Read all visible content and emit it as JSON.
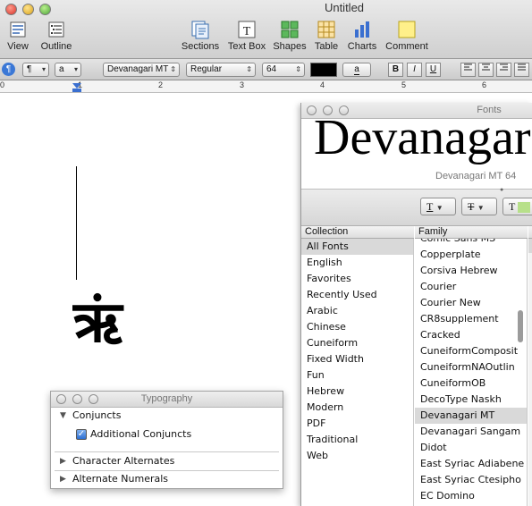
{
  "window": {
    "title": "Untitled"
  },
  "toolbar": {
    "items": [
      {
        "label": "View",
        "icon": "view-icon"
      },
      {
        "label": "Outline",
        "icon": "outline-icon"
      },
      {
        "label": "Sections",
        "icon": "sections-icon"
      },
      {
        "label": "Text Box",
        "icon": "text-box-icon"
      },
      {
        "label": "Shapes",
        "icon": "shapes-icon"
      },
      {
        "label": "Table",
        "icon": "table-icon"
      },
      {
        "label": "Charts",
        "icon": "charts-icon"
      },
      {
        "label": "Comment",
        "icon": "comment-icon"
      }
    ]
  },
  "formatbar": {
    "paragraph_style": "¶",
    "char_style": "a",
    "font_family": "Devanagari MT",
    "font_style": "Regular",
    "font_size": "64",
    "text_color": "#000000",
    "highlight_label": "a",
    "bold": "B",
    "italic": "I",
    "underline": "U"
  },
  "ruler": {
    "numbers": [
      "0",
      "1",
      "2",
      "3",
      "4",
      "5",
      "6"
    ]
  },
  "document": {
    "glyph": "ऋं"
  },
  "fonts_panel": {
    "title": "Fonts",
    "preview_text": "Devanagar",
    "preview_name": "Devanagari MT 64",
    "col_collection": "Collection",
    "col_family": "Family",
    "col_typeface": "T",
    "popup_text": "T",
    "popup_strike": "T",
    "collections": [
      "All Fonts",
      "English",
      "Favorites",
      "Recently Used",
      "Arabic",
      "Chinese",
      "Cuneiform",
      "Fixed Width",
      "Fun",
      "Hebrew",
      "Modern",
      "PDF",
      "Traditional",
      "Web"
    ],
    "families": [
      "Comic Sans MS",
      "Copperplate",
      "Corsiva Hebrew",
      "Courier",
      "Courier New",
      "CR8supplement",
      "Cracked",
      "CuneiformComposit",
      "CuneiformNAOutlin",
      "CuneiformOB",
      "DecoType Naskh",
      "Devanagari MT",
      "Devanagari Sangam",
      "Didot",
      "East Syriac Adiabene",
      "East Syriac Ctesipho",
      "EC Domino"
    ],
    "selected_collection": "All Fonts",
    "selected_family": "Devanagari MT"
  },
  "typography_panel": {
    "title": "Typography",
    "conjuncts_label": "Conjuncts",
    "additional_conjuncts_label": "Additional Conjuncts",
    "additional_conjuncts_checked": true,
    "character_alternates_label": "Character Alternates",
    "alternate_numerals_label": "Alternate Numerals"
  }
}
